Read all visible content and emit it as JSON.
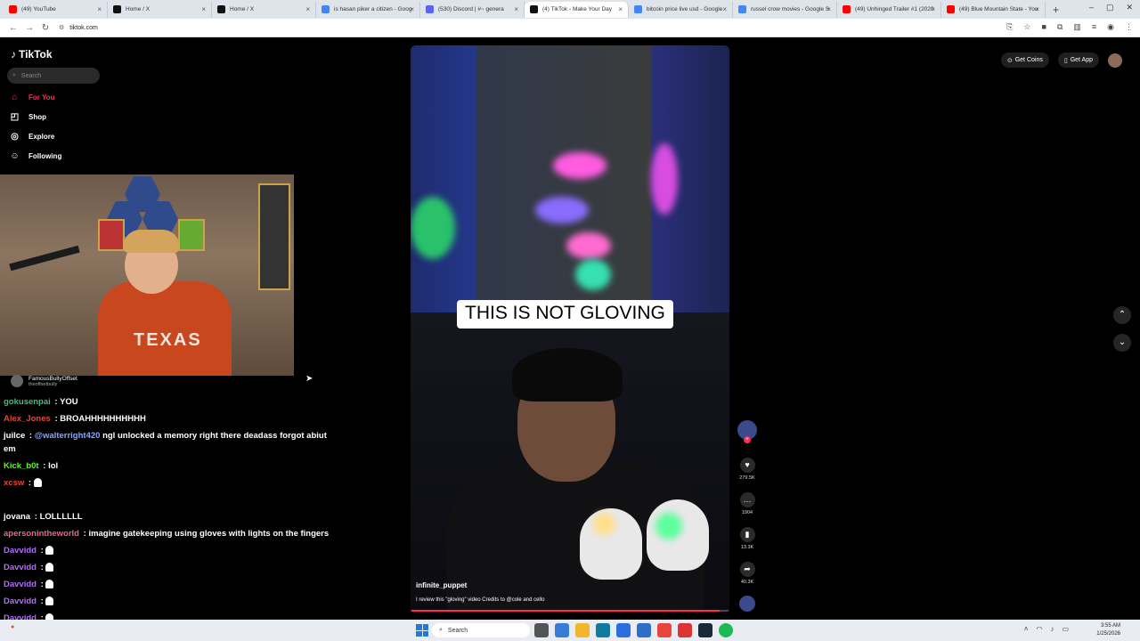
{
  "browser": {
    "tabs": [
      {
        "label": "(49) YouTube",
        "color": "#ff0000"
      },
      {
        "label": "Home / X",
        "color": "#111111"
      },
      {
        "label": "Home / X",
        "color": "#111111"
      },
      {
        "label": "is hasan piker a citizen - Goog",
        "color": "#4285f4"
      },
      {
        "label": "(530) Discord | #~ genera",
        "color": "#5865f2"
      },
      {
        "label": "(4) TikTok - Make Your Day",
        "color": "#111111",
        "active": true
      },
      {
        "label": "bitcoin price live usd - Google",
        "color": "#4285f4"
      },
      {
        "label": "russel crow movies - Google S",
        "color": "#4285f4"
      },
      {
        "label": "(49) Unhinged Trailer #1 (2020",
        "color": "#ff0000"
      },
      {
        "label": "(49) Blue Mountain State - You",
        "color": "#ff0000"
      }
    ],
    "new_tab": "+",
    "url": "tiktok.com",
    "win_min": "–",
    "win_max": "▢",
    "win_close": "✕"
  },
  "sidebar": {
    "logo": "TikTok",
    "search_placeholder": "Search",
    "nav": [
      {
        "label": "For You",
        "icon": "home-icon",
        "active": true
      },
      {
        "label": "Shop",
        "icon": "shop-bag-icon"
      },
      {
        "label": "Explore",
        "icon": "compass-icon"
      },
      {
        "label": "Following",
        "icon": "following-icon"
      }
    ],
    "following_account": {
      "name": "FamousBullyOffset",
      "handle": "theoffsetbully"
    }
  },
  "chat": [
    {
      "user": "gokusenpai",
      "color": "#3fbf7f",
      "text": "YOU"
    },
    {
      "user": "Alex_Jones",
      "color": "#e0483a",
      "text": "BROAHHHHHHHHHH"
    },
    {
      "user": "juilce",
      "color": "#ffffff",
      "text": "@walterright420 ngl unlocked a memory right there deadass forgot abiut",
      "mention": "@walterright420",
      "wrap": "em"
    },
    {
      "user": "Kick_b0t",
      "color": "#53fc18",
      "text": "lol"
    },
    {
      "user": "xcsw",
      "color": "#e0483a",
      "text": ""
    },
    {
      "user": "jovana",
      "color": "#ffffff",
      "text": "LOLLLLLL"
    },
    {
      "user": "apersonintheworld",
      "color": "#e26a8c",
      "text": "imagine gatekeeping using gloves with lights on the fingers"
    },
    {
      "user": "Davvidd",
      "color": "#b36bff",
      "text": ""
    },
    {
      "user": "Davvidd",
      "color": "#b36bff",
      "text": ""
    },
    {
      "user": "Davvidd",
      "color": "#b36bff",
      "text": ""
    },
    {
      "user": "Davvidd",
      "color": "#b36bff",
      "text": ""
    },
    {
      "user": "Davvidd",
      "color": "#b36bff",
      "text": ""
    }
  ],
  "video": {
    "caption": "THIS IS NOT GLOVING",
    "author": "infinite_puppet",
    "description": "I review this \"gloving\" video Credits to @cole and cello",
    "progress": 0.97
  },
  "actions": {
    "likes": "279.5K",
    "comments": "1904",
    "saves": "13.3K",
    "shares": "40.3K"
  },
  "topbar": {
    "get_coins": "Get Coins",
    "get_app": "Get App"
  },
  "taskbar": {
    "search_placeholder": "Search",
    "time": "3:55 AM",
    "date": "1/25/2026"
  },
  "colors": {
    "accent": "#fe2c55"
  }
}
